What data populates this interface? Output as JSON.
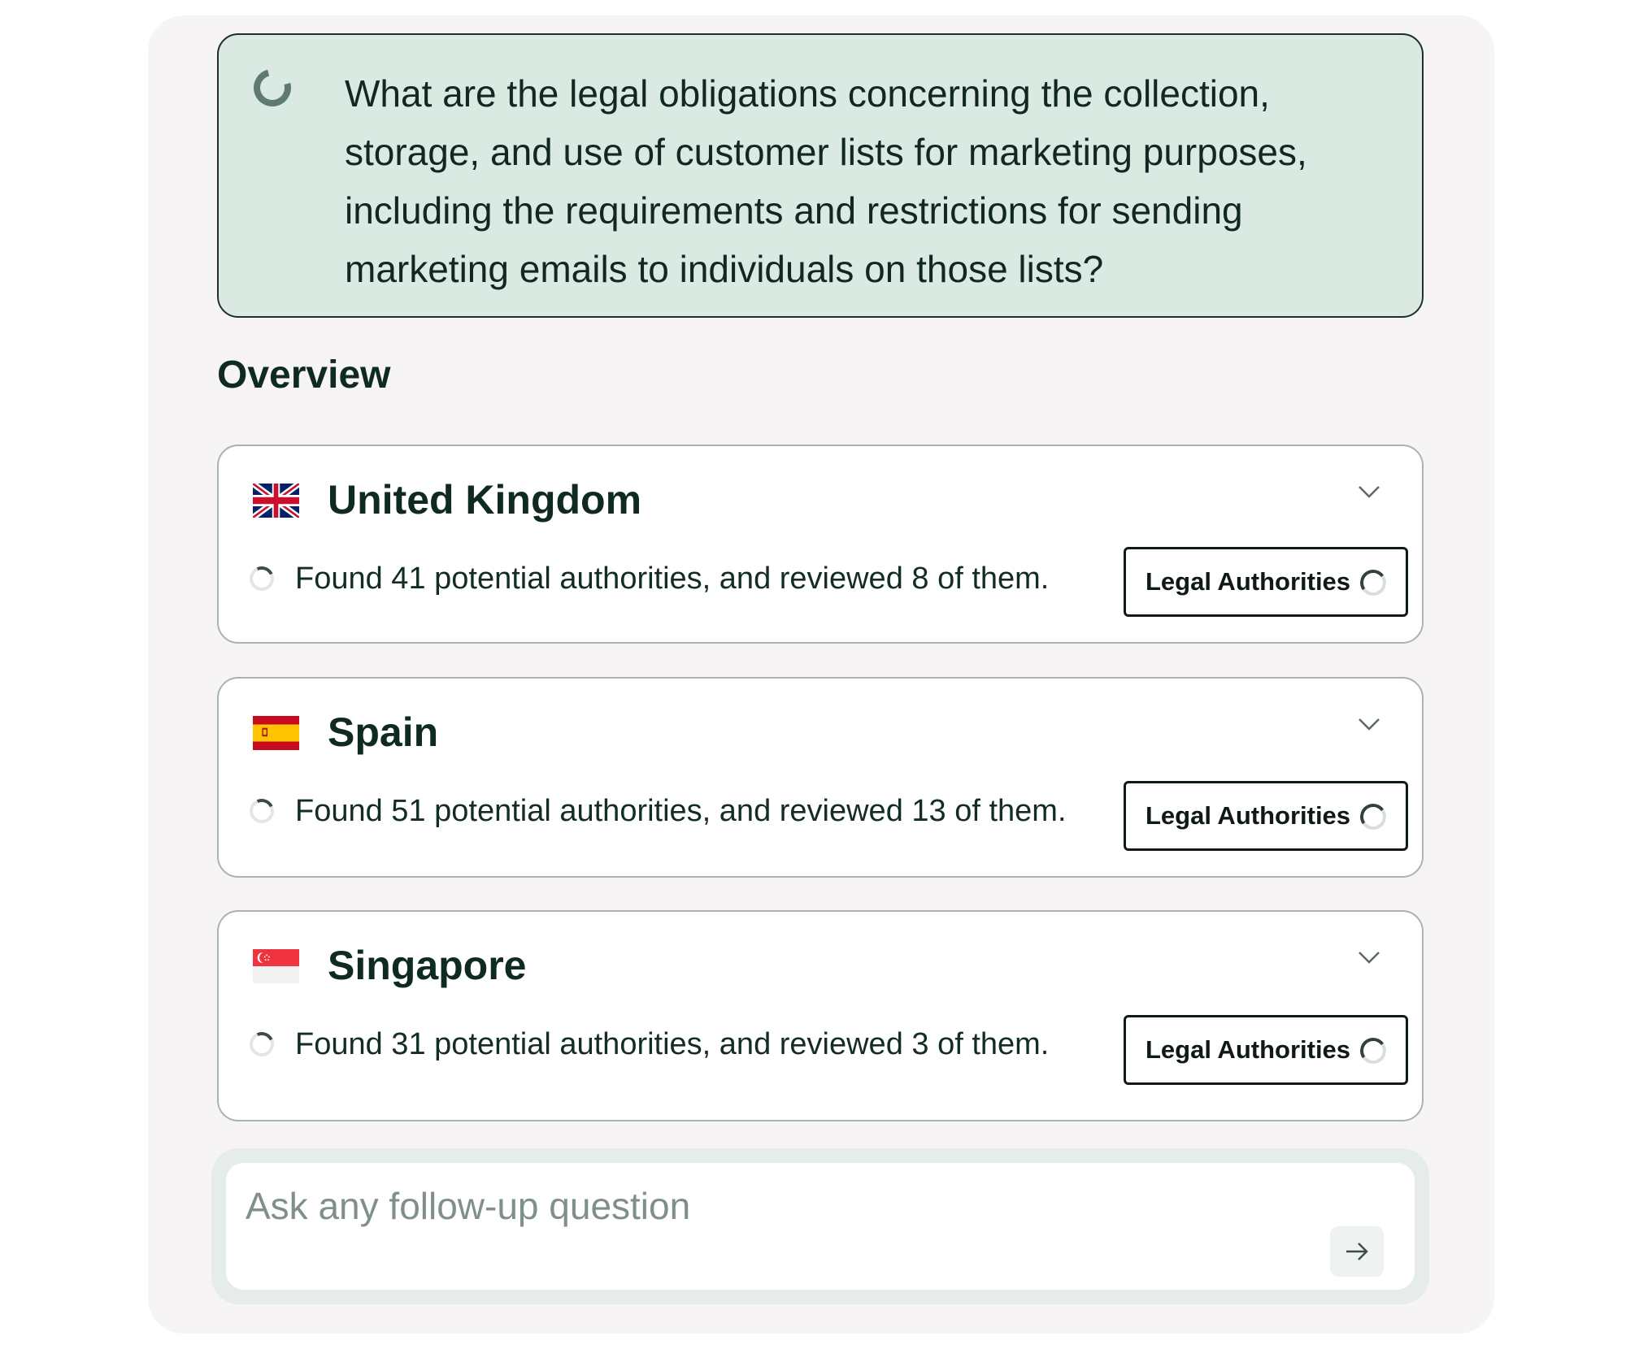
{
  "query": {
    "text": "What are the legal obligations concerning the collection, storage, and use of customer lists for marketing purposes, including the requirements and restrictions for sending marketing emails to individuals on those lists?",
    "status_icon": "loading-spinner-icon"
  },
  "overview": {
    "title": "Overview",
    "cards": [
      {
        "country": "United Kingdom",
        "flag_icon": "uk-flag-icon",
        "status": "Found 41 potential authorities, and reviewed 8 of them.",
        "button_label": "Legal Authorities"
      },
      {
        "country": "Spain",
        "flag_icon": "spain-flag-icon",
        "status": "Found 51 potential authorities, and reviewed 13 of them.",
        "button_label": "Legal Authorities"
      },
      {
        "country": "Singapore",
        "flag_icon": "singapore-flag-icon",
        "status": "Found 31 potential authorities, and reviewed 3 of them.",
        "button_label": "Legal Authorities"
      }
    ]
  },
  "followup": {
    "placeholder": "Ask any follow-up question",
    "value": "",
    "send_icon": "arrow-right-icon"
  },
  "colors": {
    "query_background": "#dbe9e3",
    "panel_background": "#f6f4f4",
    "text_primary": "#0f2a22",
    "placeholder": "#7f908a"
  }
}
